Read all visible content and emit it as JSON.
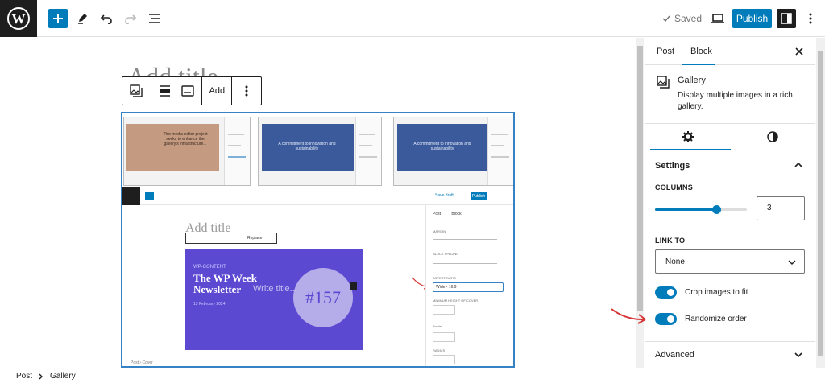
{
  "topbar": {
    "saved_label": "Saved",
    "publish_label": "Publish"
  },
  "canvas": {
    "title_placeholder": "Add title",
    "toolbar_add_label": "Add",
    "thumbnails": [
      {
        "text": "This media-editor project seeks to enhance the gallery's infrastructure..."
      },
      {
        "text": "A commitment to innovation and sustainability"
      },
      {
        "text": "A commitment to innovation and sustainability"
      }
    ],
    "inner_editor": {
      "save_draft": "Save draft",
      "publish": "Publish",
      "title_placeholder": "Add title",
      "toolbar_replace": "Replace",
      "cover": {
        "kicker": "WP-CONTENT",
        "title": "The WP Week Newsletter",
        "date": "13 February 2024",
        "badge": "#157",
        "write_title": "Write title..."
      },
      "sidebar": {
        "tab_post": "Post",
        "tab_block": "Block",
        "margin_label": "MARGIN",
        "spacing_label": "BLOCK SPACING",
        "aspect_label": "ASPECT RATIO",
        "aspect_value": "Wide - 16:9",
        "min_height_label": "MINIMUM HEIGHT OF COVER",
        "border_label": "Border",
        "radius_label": "RADIUS"
      },
      "breadcrumb": "Post  ›  Cover"
    }
  },
  "sidebar": {
    "tabs": [
      {
        "label": "Post"
      },
      {
        "label": "Block"
      }
    ],
    "block": {
      "name": "Gallery",
      "description": "Display multiple images in a rich gallery."
    },
    "settings": {
      "heading": "Settings",
      "columns_label": "COLUMNS",
      "columns_value": "3",
      "columns_fraction": 0.67,
      "link_to_label": "LINK TO",
      "link_to_value": "None",
      "crop_label": "Crop images to fit",
      "crop_enabled": true,
      "randomize_label": "Randomize order",
      "randomize_enabled": true
    },
    "advanced_label": "Advanced"
  },
  "footer": {
    "crumbs": [
      "Post",
      "Gallery"
    ]
  },
  "colors": {
    "accent": "#007cba",
    "annotation": "#d63638",
    "cover": "#5b4ad1"
  }
}
